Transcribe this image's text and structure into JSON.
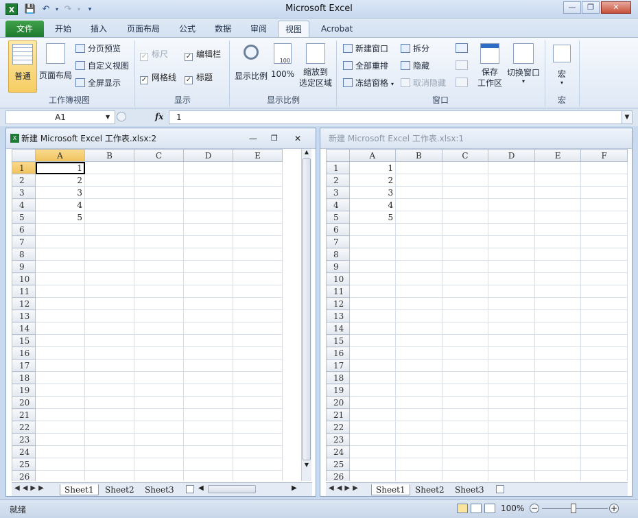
{
  "window": {
    "title": "Microsoft Excel"
  },
  "qat": {
    "save_icon": "save-icon",
    "undo_icon": "undo-icon",
    "redo_icon": "redo-icon",
    "customize_icon": "customize-qat-icon"
  },
  "tabs": [
    "文件",
    "开始",
    "插入",
    "页面布局",
    "公式",
    "数据",
    "审阅",
    "视图",
    "Acrobat"
  ],
  "active_tab": "视图",
  "ribbon": {
    "workbook_views": {
      "label": "工作簿视图",
      "normal": "普通",
      "page_layout": "页面布局",
      "page_break": "分页预览",
      "custom_views": "自定义视图",
      "full_screen": "全屏显示"
    },
    "show": {
      "label": "显示",
      "ruler": "标尺",
      "formula_bar": "编辑栏",
      "gridlines": "网格线",
      "headings": "标题"
    },
    "zoom": {
      "label": "显示比例",
      "zoom": "显示比例",
      "hundred": "100%",
      "hundred_icon_text": "100",
      "zoom_selection_1": "缩放到",
      "zoom_selection_2": "选定区域"
    },
    "window": {
      "label": "窗口",
      "new_window": "新建窗口",
      "arrange_all": "全部重排",
      "freeze_panes": "冻结窗格",
      "split": "拆分",
      "hide": "隐藏",
      "unhide": "取消隐藏",
      "save_workspace_1": "保存",
      "save_workspace_2": "工作区",
      "switch_windows": "切换窗口"
    },
    "macros": {
      "label": "宏",
      "macros": "宏"
    }
  },
  "formula_bar": {
    "name_box": "A1",
    "fx": "fx",
    "value": "1"
  },
  "workbooks": [
    {
      "title": "新建 Microsoft Excel 工作表.xlsx:2",
      "columns": [
        "A",
        "B",
        "C",
        "D",
        "E"
      ],
      "rows": [
        "1",
        "2",
        "3",
        "4",
        "5",
        "6",
        "7",
        "8",
        "9",
        "10",
        "11",
        "12",
        "13",
        "14",
        "15",
        "16",
        "17",
        "18",
        "19",
        "20",
        "21",
        "22",
        "23",
        "24",
        "25",
        "26"
      ],
      "values": [
        "1",
        "2",
        "3",
        "4",
        "5"
      ],
      "sheets": [
        "Sheet1",
        "Sheet2",
        "Sheet3"
      ]
    },
    {
      "title": "新建 Microsoft Excel 工作表.xlsx:1",
      "columns": [
        "A",
        "B",
        "C",
        "D",
        "E",
        "F"
      ],
      "rows": [
        "1",
        "2",
        "3",
        "4",
        "5",
        "6",
        "7",
        "8",
        "9",
        "10",
        "11",
        "12",
        "13",
        "14",
        "15",
        "16",
        "17",
        "18",
        "19",
        "20",
        "21",
        "22",
        "23",
        "24",
        "25",
        "26"
      ],
      "values": [
        "1",
        "2",
        "3",
        "4",
        "5"
      ],
      "sheets": [
        "Sheet1",
        "Sheet2",
        "Sheet3"
      ]
    }
  ],
  "status": {
    "text": "就绪",
    "zoom": "100%"
  }
}
